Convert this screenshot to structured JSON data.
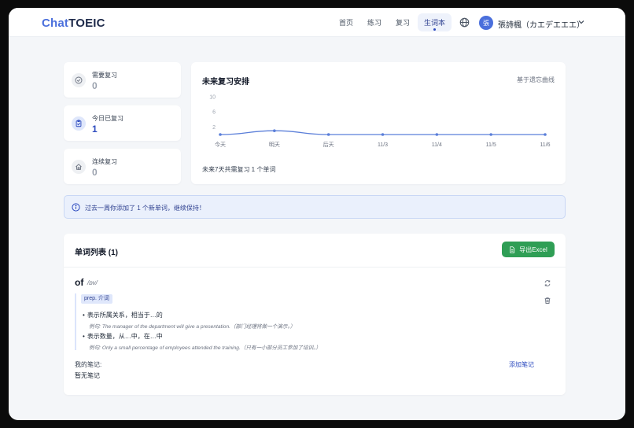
{
  "header": {
    "logo_part1": "Chat",
    "logo_part2": "TOEIC",
    "nav": [
      "首页",
      "练习",
      "复习",
      "生词本"
    ],
    "user_initial": "張",
    "user_name": "張詩楓（カエデエエエ）"
  },
  "stats": [
    {
      "label": "需要复习",
      "value": "0",
      "icon": "check-circle-icon"
    },
    {
      "label": "今日已复习",
      "value": "1",
      "icon": "clipboard-check-icon"
    },
    {
      "label": "连续复习",
      "value": "0",
      "icon": "home-icon"
    }
  ],
  "schedule": {
    "title": "未来复习安排",
    "subtitle": "基于遗忘曲线",
    "footer": "未来7天共需复习 1 个单词"
  },
  "chart_data": {
    "type": "line",
    "categories": [
      "今天",
      "明天",
      "后天",
      "11/3",
      "11/4",
      "11/5",
      "11/6"
    ],
    "values": [
      0,
      1,
      0,
      0,
      0,
      0,
      0
    ],
    "y_ticks": [
      "10",
      "6",
      "2"
    ],
    "ylim": [
      0,
      10
    ],
    "color": "#5b7fd9",
    "grid": false
  },
  "alert": {
    "text": "过去一周你添加了 1 个新单词，继续保持！"
  },
  "word_list": {
    "title": "单词列表 (1)",
    "export_label": "导出Excel",
    "entries": [
      {
        "word": "of",
        "phonetic": "/ɒv/",
        "pos": "prep. 介词",
        "senses": [
          {
            "meaning": "表示所属关系，相当于…的",
            "example": "例句: The manager of the department will give a presentation.（部门经理将做一个演示。）"
          },
          {
            "meaning": "表示数量，从…中，在…中",
            "example": "例句: Only a small percentage of employees attended the training.（只有一小部分员工参加了培训。）"
          }
        ],
        "note_label": "我的笔记:",
        "note_add": "添加笔记",
        "note_value": "暂无笔记"
      }
    ]
  },
  "colors": {
    "accent": "#4a6fdc",
    "export_green": "#2f9e55",
    "alert_bg": "#eaf0fc"
  }
}
